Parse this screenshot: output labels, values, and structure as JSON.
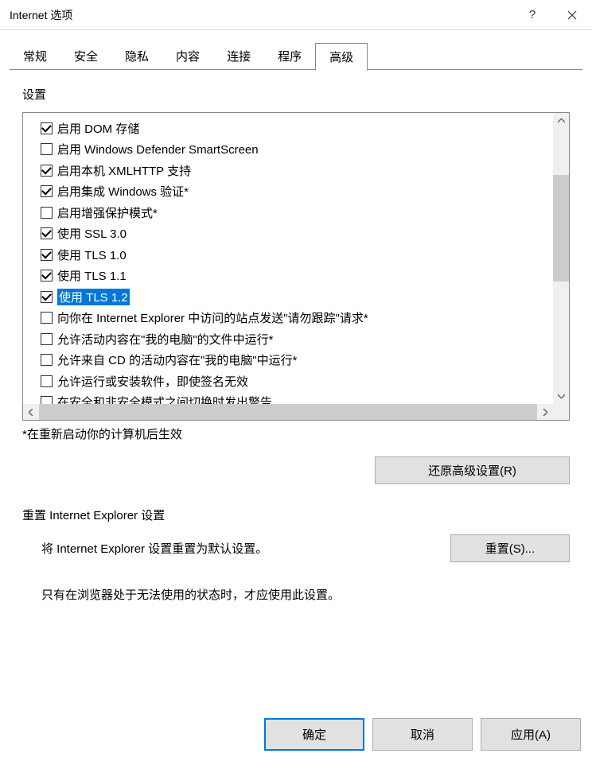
{
  "titlebar": {
    "title": "Internet 选项"
  },
  "tabs": [
    "常规",
    "安全",
    "隐私",
    "内容",
    "连接",
    "程序",
    "高级"
  ],
  "activeTabIndex": 6,
  "settingsLabel": "设置",
  "settings": [
    {
      "checked": true,
      "label": "启用 DOM 存储",
      "hl": false
    },
    {
      "checked": false,
      "label": "启用 Windows Defender SmartScreen",
      "hl": false
    },
    {
      "checked": true,
      "label": "启用本机 XMLHTTP 支持",
      "hl": false
    },
    {
      "checked": true,
      "label": "启用集成 Windows 验证*",
      "hl": false
    },
    {
      "checked": false,
      "label": "启用增强保护模式*",
      "hl": false
    },
    {
      "checked": true,
      "label": "使用 SSL 3.0",
      "hl": false
    },
    {
      "checked": true,
      "label": "使用 TLS 1.0",
      "hl": false
    },
    {
      "checked": true,
      "label": "使用 TLS 1.1",
      "hl": false
    },
    {
      "checked": true,
      "label": "使用 TLS 1.2",
      "hl": true
    },
    {
      "checked": false,
      "label": "向你在 Internet Explorer 中访问的站点发送\"请勿跟踪\"请求*",
      "hl": false
    },
    {
      "checked": false,
      "label": "允许活动内容在\"我的电脑\"的文件中运行*",
      "hl": false
    },
    {
      "checked": false,
      "label": "允许来自 CD 的活动内容在\"我的电脑\"中运行*",
      "hl": false
    },
    {
      "checked": false,
      "label": "允许运行或安装软件，即使签名无效",
      "hl": false
    },
    {
      "checked": false,
      "label": "在安全和非安全模式之间切换时发出警告",
      "hl": false
    }
  ],
  "restartNote": "*在重新启动你的计算机后生效",
  "restoreBtn": "还原高级设置(R)",
  "resetSection": {
    "heading": "重置 Internet Explorer 设置",
    "desc": "将 Internet Explorer 设置重置为默认设置。",
    "btn": "重置(S)...",
    "note": "只有在浏览器处于无法使用的状态时，才应使用此设置。"
  },
  "footer": {
    "ok": "确定",
    "cancel": "取消",
    "apply": "应用(A)"
  }
}
